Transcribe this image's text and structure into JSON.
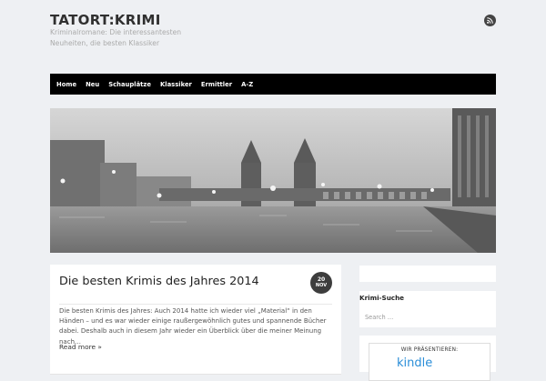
{
  "site": {
    "title": "TATORT:KRIMI",
    "description": "Kriminalromane: Die interessantesten Neuheiten, die besten Klassiker"
  },
  "header": {
    "rss_icon": "rss-icon"
  },
  "nav": {
    "items": [
      "Home",
      "Neu",
      "Schauplätze",
      "Klassiker",
      "Ermittler",
      "A-Z"
    ]
  },
  "hero": {
    "image": "foggy-bridge-night-photo"
  },
  "post": {
    "title": "Die besten Krimis des Jahres 2014",
    "date_day": "20",
    "date_month": "NOV",
    "excerpt": "Die besten Krimis des Jahres: Auch 2014 hatte ich wieder viel „Material“ in den Händen – und es war wieder einige raußergewöhnlich gutes und spannende Bücher dabei. Deshalb auch in diesem Jahr wieder ein Überblick über die meiner Meinung nach…",
    "read_more": "Read more »"
  },
  "sidebar": {
    "search_title": "Krimi-Suche",
    "search_placeholder": "Search …",
    "promo_label": "WIR PRÄSENTIEREN:",
    "promo_logo": "kindle"
  },
  "colors": {
    "nav_bg": "#000000",
    "page_bg": "#eef0f3",
    "badge": "#3d3d3d"
  }
}
